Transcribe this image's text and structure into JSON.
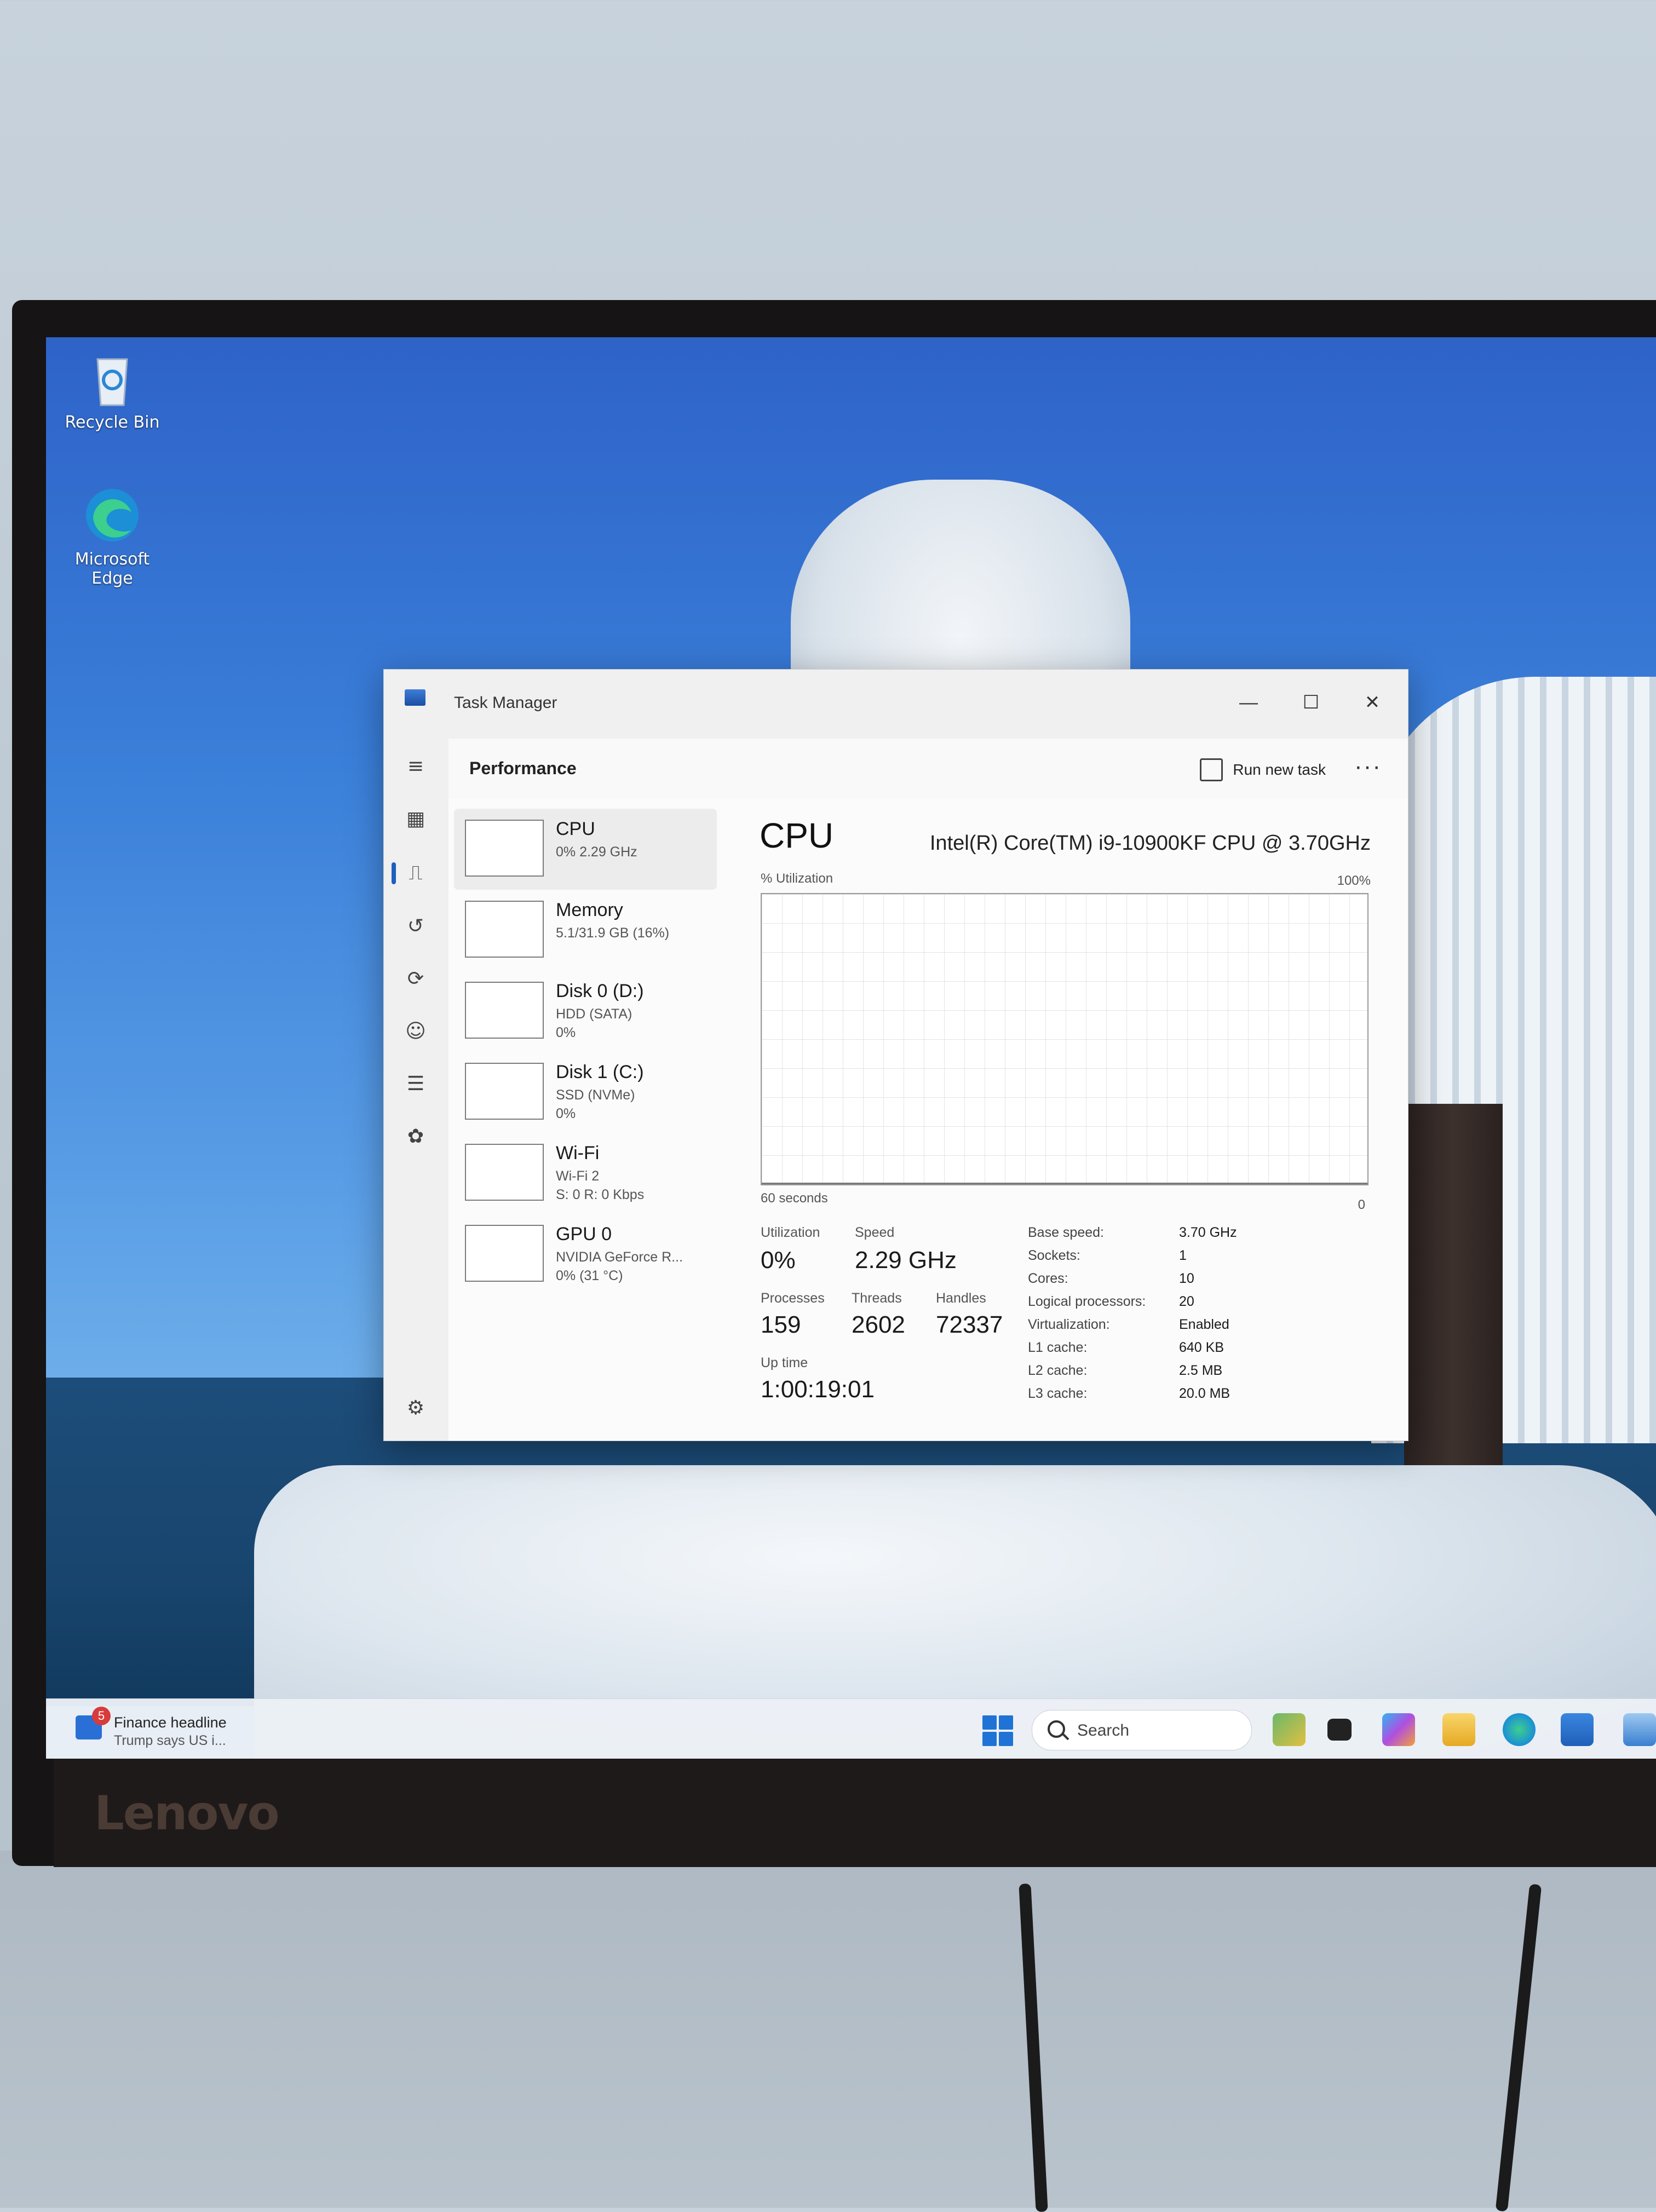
{
  "desktop": {
    "icons": [
      {
        "label": "Recycle Bin"
      },
      {
        "label": "Microsoft\nEdge"
      }
    ]
  },
  "monitor": {
    "brand": "Lenovo"
  },
  "task_manager": {
    "window_title": "Task Manager",
    "controls": {
      "minimize": "—",
      "maximize": "☐",
      "close": "✕"
    },
    "nav_icons": [
      "menu-icon",
      "processes-icon",
      "performance-icon",
      "app-history-icon",
      "startup-icon",
      "users-icon",
      "details-icon",
      "services-icon",
      "settings-icon"
    ],
    "header": {
      "title": "Performance",
      "run_new_task": "Run new task",
      "more": "···"
    },
    "resources": [
      {
        "name": "CPU",
        "sub": "0% 2.29 GHz"
      },
      {
        "name": "Memory",
        "sub": "5.1/31.9 GB (16%)"
      },
      {
        "name": "Disk 0 (D:)",
        "sub": "HDD (SATA)\n0%"
      },
      {
        "name": "Disk 1 (C:)",
        "sub": "SSD (NVMe)\n0%"
      },
      {
        "name": "Wi-Fi",
        "sub": "Wi-Fi 2\nS: 0 R: 0 Kbps"
      },
      {
        "name": "GPU 0",
        "sub": "NVIDIA GeForce R...\n0% (31 °C)"
      }
    ],
    "detail": {
      "title": "CPU",
      "model": "Intel(R) Core(TM) i9-10900KF CPU @ 3.70GHz",
      "graph": {
        "y_label": "% Utilization",
        "y_max": "100%",
        "x_label": "60 seconds",
        "x_min": "0"
      },
      "stats": {
        "utilization_label": "Utilization",
        "utilization": "0%",
        "speed_label": "Speed",
        "speed": "2.29 GHz",
        "processes_label": "Processes",
        "processes": "159",
        "threads_label": "Threads",
        "threads": "2602",
        "handles_label": "Handles",
        "handles": "72337",
        "uptime_label": "Up time",
        "uptime": "1:00:19:01"
      },
      "specs": [
        {
          "key": "Base speed:",
          "value": "3.70 GHz"
        },
        {
          "key": "Sockets:",
          "value": "1"
        },
        {
          "key": "Cores:",
          "value": "10"
        },
        {
          "key": "Logical processors:",
          "value": "20"
        },
        {
          "key": "Virtualization:",
          "value": "Enabled"
        },
        {
          "key": "L1 cache:",
          "value": "640 KB"
        },
        {
          "key": "L2 cache:",
          "value": "2.5 MB"
        },
        {
          "key": "L3 cache:",
          "value": "20.0 MB"
        }
      ]
    }
  },
  "taskbar": {
    "widget": {
      "badge": "5",
      "title": "Finance headline",
      "subtitle": "Trump says US i..."
    },
    "search_placeholder": "Search",
    "apps": [
      "widgets-icon",
      "task-view-icon",
      "copilot-icon",
      "file-explorer-icon",
      "edge-icon",
      "store-icon",
      "photos-icon"
    ],
    "colors": {
      "start": "#1f73d6",
      "accent": "#1e5fbf"
    }
  }
}
